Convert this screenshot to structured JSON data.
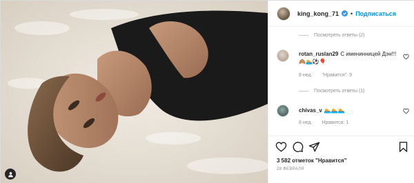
{
  "post": {
    "author": {
      "username": "king_kong_71",
      "follow_label": "Подписаться",
      "separator": "•"
    },
    "comments": [
      {
        "type": "replies",
        "label": "Посмотреть ответы (2)"
      },
      {
        "type": "comment",
        "username": "rotan_ruslan29",
        "text": "С именинницей Дэн!!!🙈🏊⚽🎈",
        "time": "8 нед.",
        "likes": "\"Нравится\": 9"
      },
      {
        "type": "replies",
        "label": "Посмотреть ответы (1)"
      },
      {
        "type": "comment",
        "username": "chivas_v",
        "text": "🏊🏊🏊",
        "time": "8 нед.",
        "likes": "Нравится: 1"
      }
    ],
    "likes_count": "3 582 отметок \"Нравится\"",
    "date": "28 ФЕВРАЛЯ"
  },
  "icons": {
    "like": "heart-icon",
    "comment": "comment-icon",
    "share": "share-icon",
    "save": "bookmark-icon",
    "verified": "verified-badge-icon"
  },
  "colors": {
    "accent": "#0095f6",
    "text": "#262626",
    "muted": "#8e8e8e",
    "border": "#dbdbdb"
  }
}
